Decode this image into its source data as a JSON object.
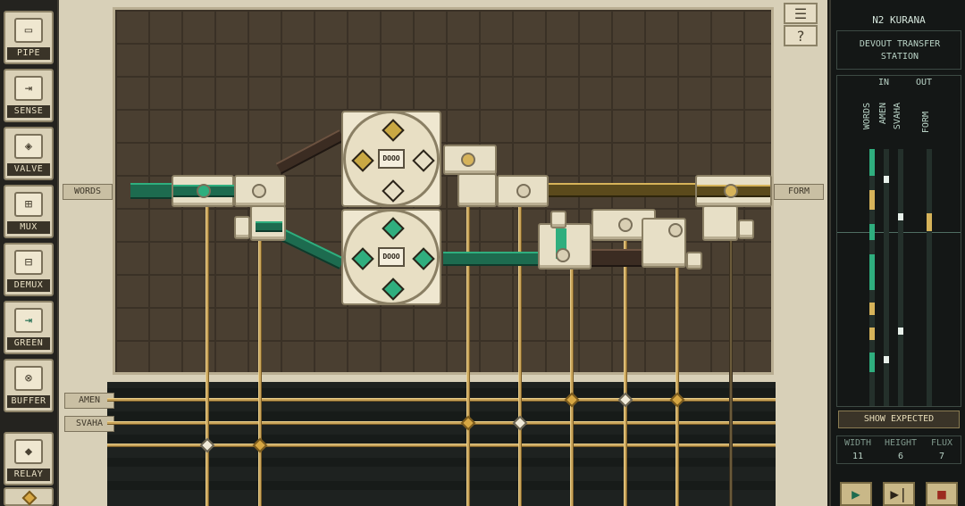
{
  "palette": [
    {
      "label": "PIPE",
      "icon": "pipe-icon",
      "glyph": "▭"
    },
    {
      "label": "SENSE",
      "icon": "sense-icon",
      "glyph": "⇥"
    },
    {
      "label": "VALVE",
      "icon": "valve-icon",
      "glyph": "◈"
    },
    {
      "label": "MUX",
      "icon": "mux-icon",
      "glyph": "⊞"
    },
    {
      "label": "DEMUX",
      "icon": "demux-icon",
      "glyph": "⊟"
    },
    {
      "label": "GREEN",
      "icon": "green-icon",
      "glyph": "⇥"
    },
    {
      "label": "BUFFER",
      "icon": "buffer-icon",
      "glyph": "⊗"
    },
    {
      "label": "RELAY",
      "icon": "relay-icon",
      "glyph": "◆"
    }
  ],
  "board": {
    "inputs": [
      "WORDS"
    ],
    "outputs": [
      "FORM"
    ],
    "signals": [
      "AMEN",
      "SVAHA"
    ],
    "buffer_label": "DOOO"
  },
  "menu_glyph": "☰",
  "help_glyph": "?",
  "panel": {
    "location": "N2 KURANA",
    "station": "DEVOUT TRANSFER STATION",
    "in_label": "IN",
    "out_label": "OUT",
    "channels": [
      "WORDS",
      "AMEN",
      "SVAHA",
      "FORM"
    ],
    "show_expected": "SHOW EXPECTED",
    "stats_headers": [
      "WIDTH",
      "HEIGHT",
      "FLUX"
    ],
    "stats_values": [
      "11",
      "6",
      "7"
    ]
  },
  "colors": {
    "green": "#2fae7e",
    "gold": "#d6b35a",
    "background": "#4a3f31"
  }
}
